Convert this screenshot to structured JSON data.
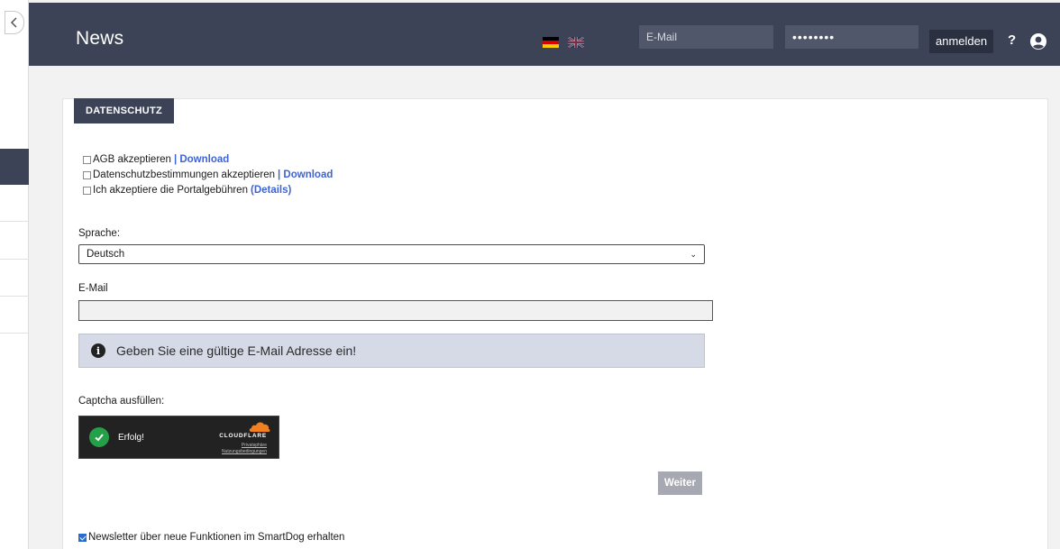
{
  "header": {
    "title": "News",
    "email_placeholder": "E-Mail",
    "password_value": "••••••••",
    "login_label": "anmelden",
    "help_label": "?"
  },
  "section_tab": "DATENSCHUTZ",
  "checkboxes": [
    {
      "label": "AGB akzeptieren",
      "link": "| Download",
      "checked": false
    },
    {
      "label": "Datenschutzbestimmungen akzeptieren",
      "link": "| Download",
      "checked": false
    },
    {
      "label": "Ich akzeptiere die Portalgebühren",
      "link": "(Details)",
      "checked": false
    }
  ],
  "language": {
    "label": "Sprache:",
    "selected": "Deutsch"
  },
  "email": {
    "label": "E-Mail",
    "value": ""
  },
  "alert_text": "Geben Sie eine gültige E-Mail Adresse ein!",
  "captcha": {
    "label": "Captcha ausfüllen:",
    "status": "Erfolg!",
    "brand": "CLOUDFLARE",
    "privacy": "Privatsphäre",
    "terms": "Nutzungsbedingungen"
  },
  "next_label": "Weiter",
  "newsletter": {
    "label": "Newsletter über neue Funktionen im SmartDog erhalten",
    "checked": true
  },
  "colors": {
    "header_bg": "#3c4356",
    "link": "#3d63d8",
    "alert_bg": "#d5dae6",
    "success": "#24a148",
    "cf_orange": "#f38020"
  },
  "icons": [
    "chevron-left-icon",
    "flag-de-icon",
    "flag-uk-icon",
    "user-icon",
    "info-icon",
    "checkmark-icon",
    "cloudflare-icon",
    "chevron-down-icon"
  ]
}
